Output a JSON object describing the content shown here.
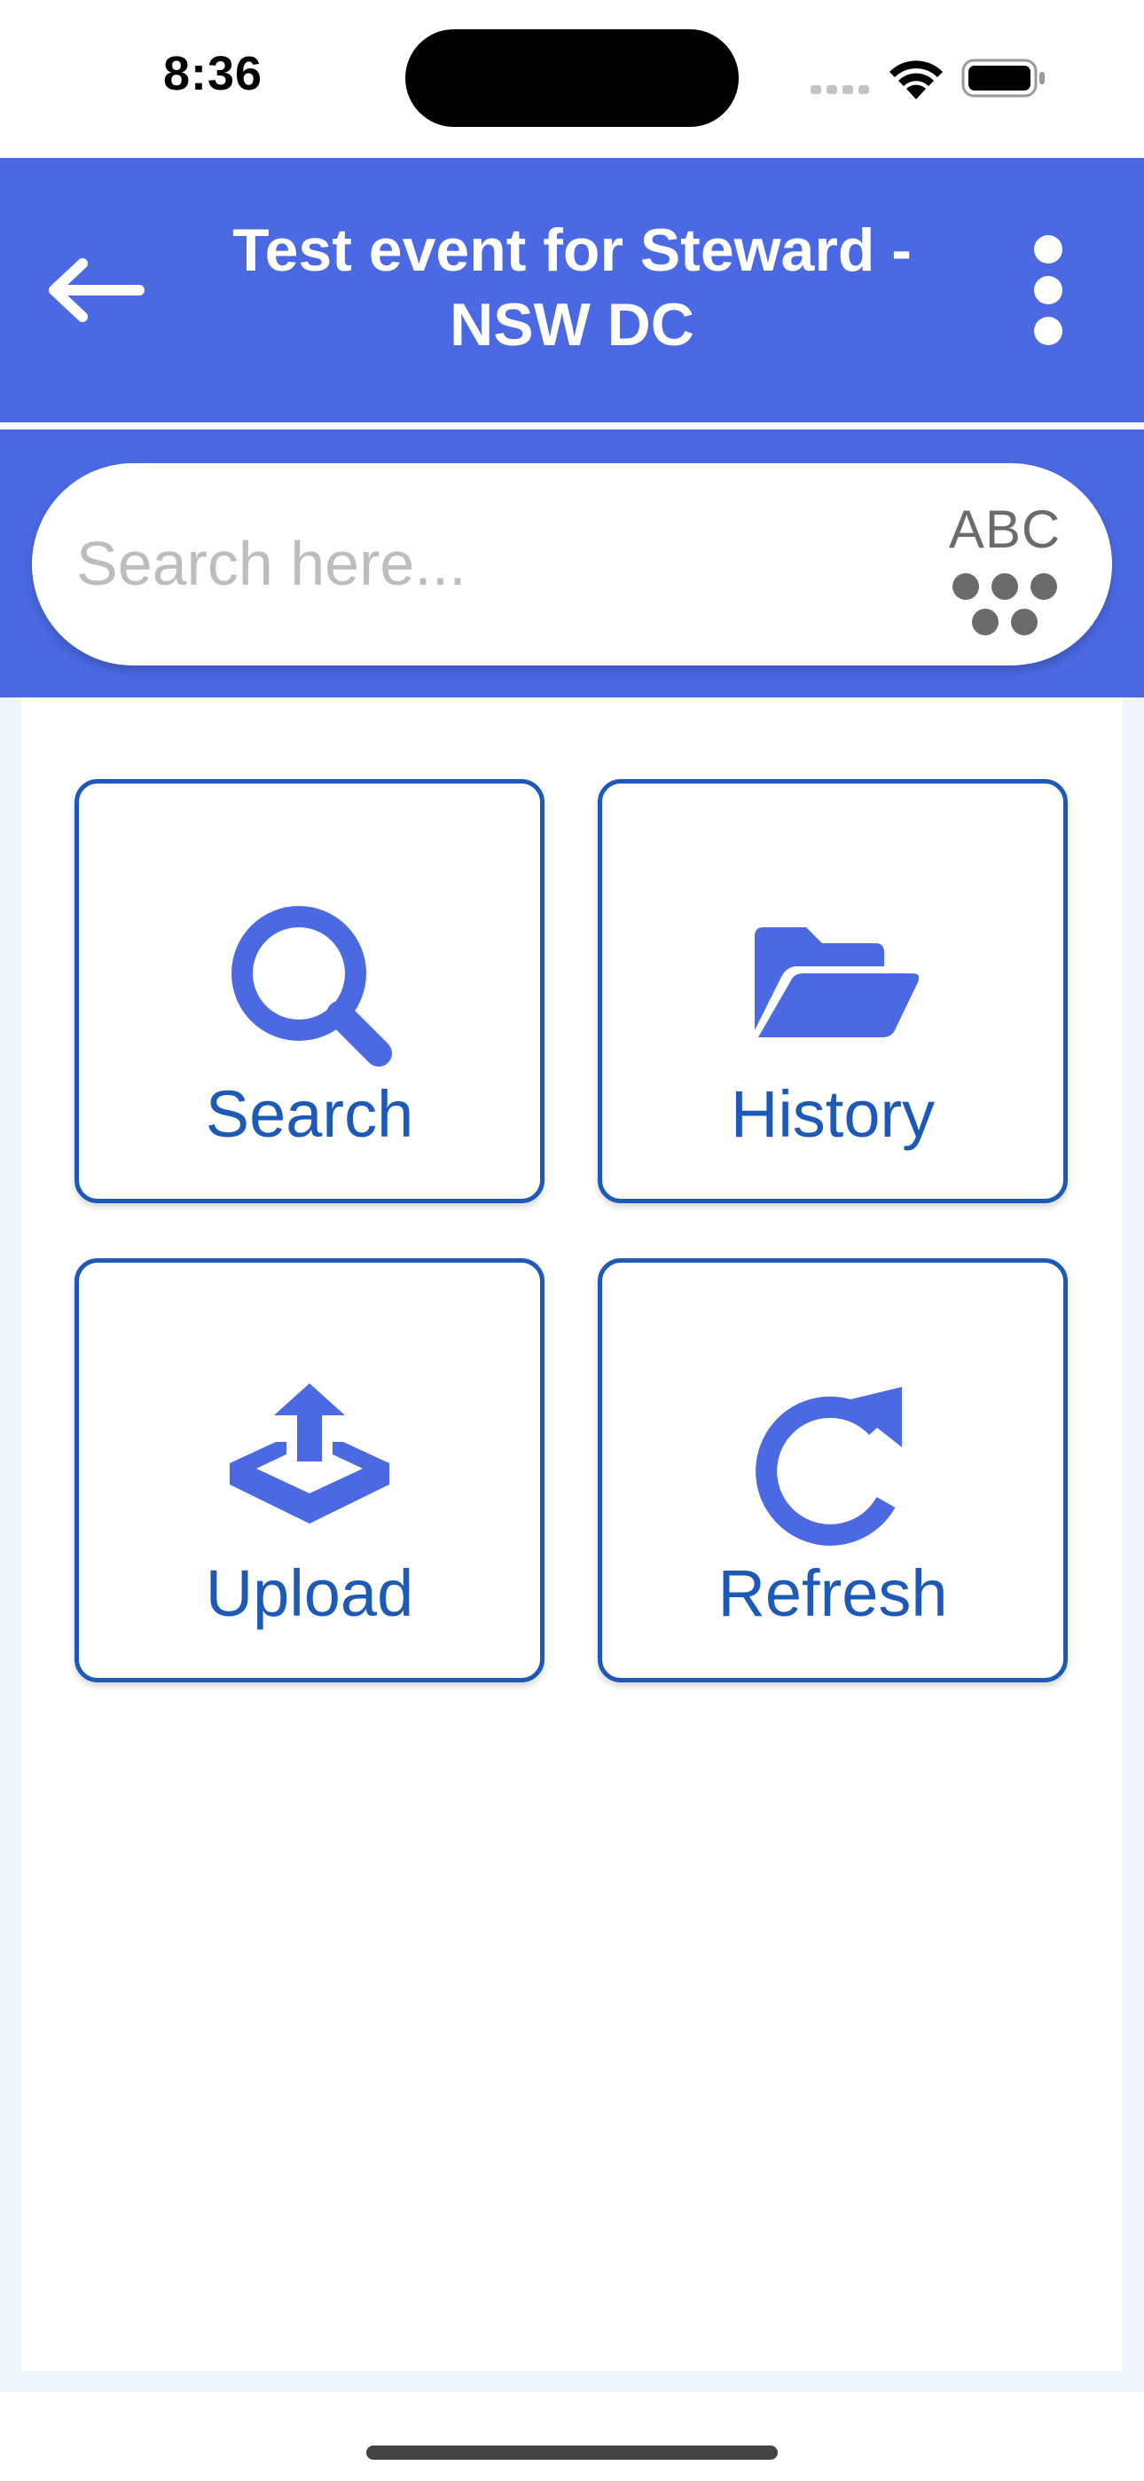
{
  "status_bar": {
    "time": "8:36"
  },
  "header": {
    "title_line1": "Test event for Steward -",
    "title_line2": "NSW DC",
    "back_icon": "arrow-left-icon",
    "menu_icon": "more-vertical-icon"
  },
  "search": {
    "placeholder": "Search here...",
    "keyboard_toggle_label": "ABC"
  },
  "actions": [
    {
      "label": "Search",
      "icon": "search-icon"
    },
    {
      "label": "History",
      "icon": "folder-open-icon"
    },
    {
      "label": "Upload",
      "icon": "upload-icon"
    },
    {
      "label": "Refresh",
      "icon": "refresh-icon"
    }
  ],
  "colors": {
    "header_bg": "#4a69e2",
    "tile_border": "#1d5ab8",
    "icon_fill": "#4a69e2",
    "content_bg": "#f1f5fc"
  }
}
